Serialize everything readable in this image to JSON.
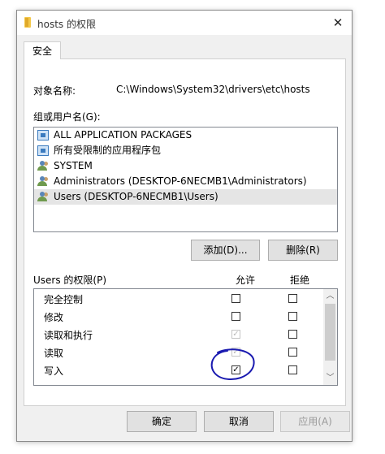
{
  "window": {
    "title": "hosts 的权限"
  },
  "tabs": [
    {
      "label": "安全"
    }
  ],
  "object": {
    "label": "对象名称:",
    "value": "C:\\Windows\\System32\\drivers\\etc\\hosts"
  },
  "groups": {
    "label": "组或用户名(G):",
    "items": [
      {
        "label": "ALL APPLICATION PACKAGES",
        "icon": "package-icon"
      },
      {
        "label": "所有受限制的应用程序包",
        "icon": "package-icon"
      },
      {
        "label": "SYSTEM",
        "icon": "users-icon"
      },
      {
        "label": "Administrators (DESKTOP-6NECMB1\\Administrators)",
        "icon": "users-icon"
      },
      {
        "label": "Users (DESKTOP-6NECMB1\\Users)",
        "icon": "users-icon",
        "selected": true
      }
    ],
    "add_button": "添加(D)...",
    "remove_button": "删除(R)"
  },
  "permissions": {
    "title": "Users 的权限(P)",
    "allow_header": "允许",
    "deny_header": "拒绝",
    "rows": [
      {
        "name": "完全控制",
        "allow": false,
        "deny": false,
        "allow_disabled": false
      },
      {
        "name": "修改",
        "allow": false,
        "deny": false,
        "allow_disabled": false
      },
      {
        "name": "读取和执行",
        "allow": true,
        "deny": false,
        "allow_disabled": true
      },
      {
        "name": "读取",
        "allow": true,
        "deny": false,
        "allow_disabled": true
      },
      {
        "name": "写入",
        "allow": true,
        "deny": false,
        "allow_disabled": false
      }
    ]
  },
  "footer": {
    "ok": "确定",
    "cancel": "取消",
    "apply": "应用(A)"
  },
  "colors": {
    "annotation": "#1a1ab0",
    "selection": "#e5e5e5"
  }
}
